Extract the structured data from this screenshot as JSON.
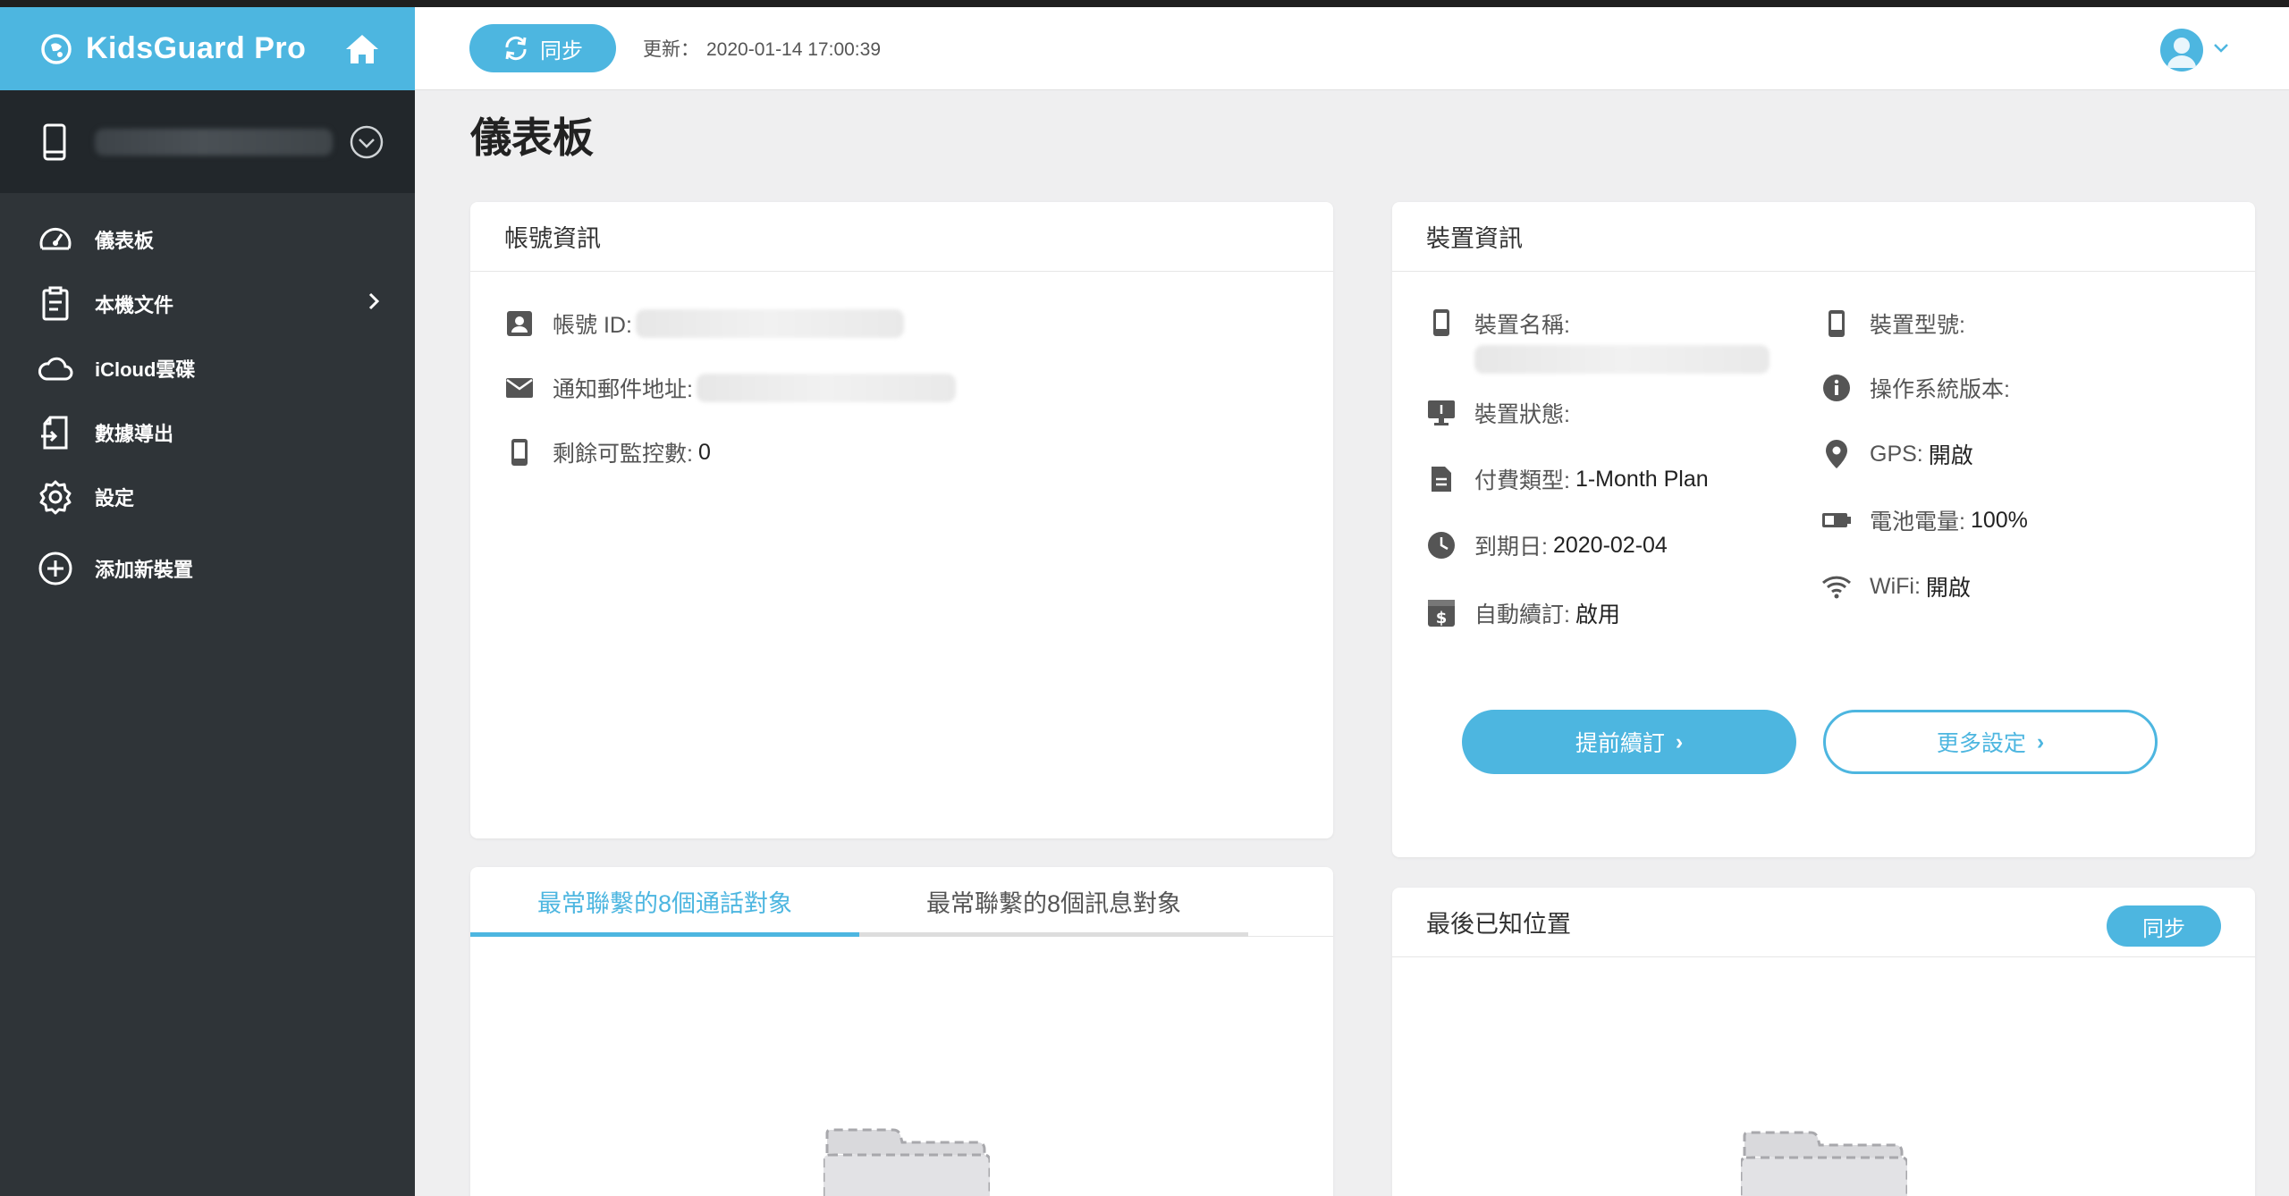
{
  "brand": {
    "name": "KidsGuard Pro",
    "logo_icon": "kidsguard-logo-icon",
    "home_icon": "home-icon"
  },
  "sidebar": {
    "device_icon": "phone-icon",
    "items": [
      {
        "label": "儀表板",
        "icon": "dashboard-gauge-icon"
      },
      {
        "label": "本機文件",
        "icon": "document-icon",
        "has_arrow": true
      },
      {
        "label": "iCloud雲碟",
        "icon": "cloud-icon"
      },
      {
        "label": "數據導出",
        "icon": "export-icon"
      },
      {
        "label": "設定",
        "icon": "gear-icon"
      },
      {
        "label": "添加新裝置",
        "icon": "add-circle-icon"
      }
    ]
  },
  "header": {
    "sync_label": "同步",
    "updated_label": "更新：",
    "updated_time": "2020-01-14 17:00:39"
  },
  "page": {
    "title": "儀表板"
  },
  "account_card": {
    "title": "帳號資訊",
    "account_id_label": "帳號 ID:",
    "email_label": "通知郵件地址:",
    "remaining_label": "剩餘可監控數:",
    "remaining_value": "0"
  },
  "device_card": {
    "title": "裝置資訊",
    "device_name_label": "裝置名稱:",
    "device_status_label": "裝置狀態:",
    "payment_type_label": "付費類型:",
    "payment_type_value": "1-Month Plan",
    "expiry_label": "到期日:",
    "expiry_value": "2020-02-04",
    "auto_renew_label": "自動續訂:",
    "auto_renew_value": "啟用",
    "device_model_label": "裝置型號:",
    "os_version_label": "操作系統版本:",
    "gps_label": "GPS:",
    "gps_value": "開啟",
    "battery_label": "電池電量:",
    "battery_value": "100%",
    "wifi_label": "WiFi:",
    "wifi_value": "開啟",
    "renew_button": "提前續訂",
    "more_settings_button": "更多設定",
    "button_arrow": "›"
  },
  "contacts_card": {
    "tabs": [
      "最常聯繫的8個通話對象",
      "最常聯繫的8個訊息對象"
    ],
    "active_tab": 0
  },
  "location_card": {
    "title": "最後已知位置",
    "sync_label": "同步"
  },
  "colors": {
    "accent": "#4db6e0",
    "sidebar": "#2f3438",
    "sidebar_dark": "#22272b"
  }
}
